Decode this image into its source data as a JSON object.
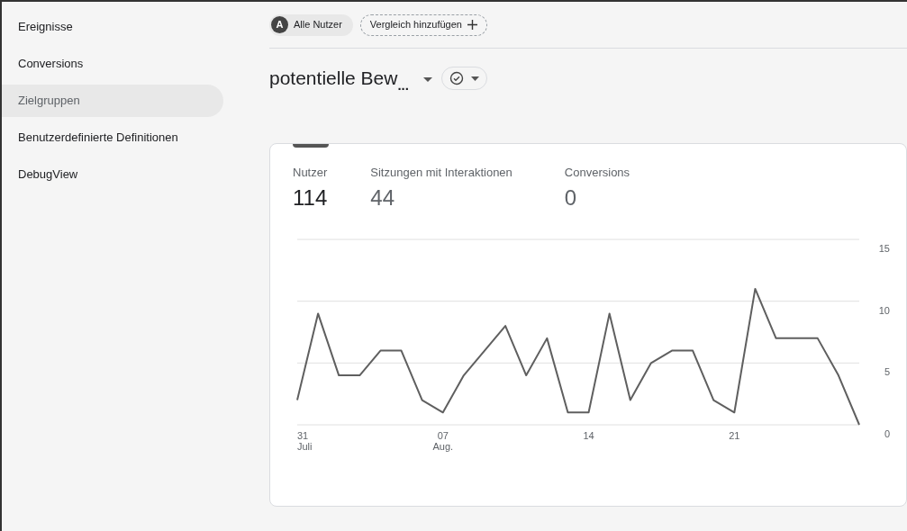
{
  "sidebar": {
    "items": [
      {
        "label": "Ereignisse",
        "selected": false
      },
      {
        "label": "Conversions",
        "selected": false
      },
      {
        "label": "Zielgruppen",
        "selected": true
      },
      {
        "label": "Benutzerdefinierte Definitionen",
        "selected": false
      },
      {
        "label": "DebugView",
        "selected": false
      }
    ]
  },
  "toolbar": {
    "segment_chip": {
      "avatar": "A",
      "label": "Alle Nutzer"
    },
    "compare_button": "Vergleich hinzufügen"
  },
  "heading": {
    "title": "potentielle Bew",
    "ellipsis": "..."
  },
  "metrics": [
    {
      "label": "Nutzer",
      "value": "114",
      "selected": true
    },
    {
      "label": "Sitzungen mit Interaktionen",
      "value": "44",
      "selected": false
    },
    {
      "label": "Conversions",
      "value": "0",
      "selected": false
    }
  ],
  "chart_data": {
    "type": "line",
    "x": [
      0,
      1,
      2,
      3,
      4,
      5,
      6,
      7,
      8,
      9,
      10,
      11,
      12,
      13,
      14,
      15,
      16,
      17,
      18,
      19,
      20,
      21,
      22,
      23,
      24,
      25,
      26,
      27
    ],
    "series": [
      {
        "color": "#5f5f5f",
        "values": [
          2,
          9,
          4,
          4,
          6,
          6,
          2,
          1,
          4,
          6,
          8,
          4,
          7,
          1,
          1,
          9,
          2,
          5,
          6,
          6,
          2,
          1,
          11,
          7,
          7,
          7,
          4,
          0
        ]
      }
    ],
    "xlim": [
      0,
      27
    ],
    "ylim": [
      0,
      15
    ],
    "xticks": [
      {
        "value": 0,
        "label": "31 Juli"
      },
      {
        "value": 7,
        "label": "07 Aug."
      },
      {
        "value": 14,
        "label": "14"
      },
      {
        "value": 21,
        "label": "21"
      }
    ],
    "yticks": [
      0,
      5,
      10,
      15
    ]
  }
}
